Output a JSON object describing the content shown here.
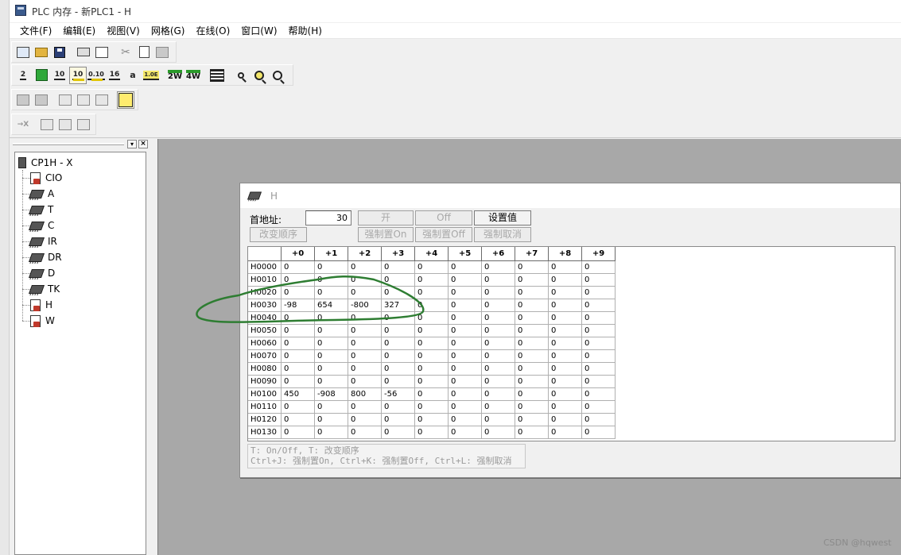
{
  "window": {
    "title": "PLC 内存 - 新PLC1 - H"
  },
  "menu": [
    "文件(F)",
    "编辑(E)",
    "视图(V)",
    "网格(G)",
    "在线(O)",
    "窗口(W)",
    "帮助(H)"
  ],
  "toolbar": {
    "row2_labels": [
      "2",
      "10",
      "10",
      "16",
      "a",
      "2W",
      "4W"
    ]
  },
  "tree": {
    "root": "CP1H - X",
    "items": [
      {
        "label": "CIO",
        "icon": "memory-doc-icon"
      },
      {
        "label": "A",
        "icon": "memory-chip-icon"
      },
      {
        "label": "T",
        "icon": "memory-chip-icon"
      },
      {
        "label": "C",
        "icon": "memory-chip-icon"
      },
      {
        "label": "IR",
        "icon": "memory-chip-icon"
      },
      {
        "label": "DR",
        "icon": "memory-chip-icon"
      },
      {
        "label": "D",
        "icon": "memory-chip-icon"
      },
      {
        "label": "TK",
        "icon": "memory-chip-icon"
      },
      {
        "label": "H",
        "icon": "memory-doc-icon"
      },
      {
        "label": "W",
        "icon": "memory-doc-icon"
      }
    ]
  },
  "child": {
    "title": "H",
    "address_label": "首地址:",
    "address_value": "30",
    "buttons": {
      "on": "开",
      "off": "Off",
      "set_value": "设置值",
      "change_order": "改变顺序",
      "force_on": "强制置On",
      "force_off": "强制置Off",
      "force_cancel": "强制取消"
    },
    "columns": [
      "+0",
      "+1",
      "+2",
      "+3",
      "+4",
      "+5",
      "+6",
      "+7",
      "+8",
      "+9"
    ],
    "rows": [
      {
        "addr": "H0000",
        "vals": [
          "0",
          "0",
          "0",
          "0",
          "0",
          "0",
          "0",
          "0",
          "0",
          "0"
        ]
      },
      {
        "addr": "H0010",
        "vals": [
          "0",
          "0",
          "0",
          "0",
          "0",
          "0",
          "0",
          "0",
          "0",
          "0"
        ]
      },
      {
        "addr": "H0020",
        "vals": [
          "0",
          "0",
          "0",
          "0",
          "0",
          "0",
          "0",
          "0",
          "0",
          "0"
        ]
      },
      {
        "addr": "H0030",
        "vals": [
          "-98",
          "654",
          "-800",
          "327",
          "0",
          "0",
          "0",
          "0",
          "0",
          "0"
        ]
      },
      {
        "addr": "H0040",
        "vals": [
          "0",
          "0",
          "0",
          "0",
          "0",
          "0",
          "0",
          "0",
          "0",
          "0"
        ]
      },
      {
        "addr": "H0050",
        "vals": [
          "0",
          "0",
          "0",
          "0",
          "0",
          "0",
          "0",
          "0",
          "0",
          "0"
        ]
      },
      {
        "addr": "H0060",
        "vals": [
          "0",
          "0",
          "0",
          "0",
          "0",
          "0",
          "0",
          "0",
          "0",
          "0"
        ]
      },
      {
        "addr": "H0070",
        "vals": [
          "0",
          "0",
          "0",
          "0",
          "0",
          "0",
          "0",
          "0",
          "0",
          "0"
        ]
      },
      {
        "addr": "H0080",
        "vals": [
          "0",
          "0",
          "0",
          "0",
          "0",
          "0",
          "0",
          "0",
          "0",
          "0"
        ]
      },
      {
        "addr": "H0090",
        "vals": [
          "0",
          "0",
          "0",
          "0",
          "0",
          "0",
          "0",
          "0",
          "0",
          "0"
        ]
      },
      {
        "addr": "H0100",
        "vals": [
          "450",
          "-908",
          "800",
          "-56",
          "0",
          "0",
          "0",
          "0",
          "0",
          "0"
        ]
      },
      {
        "addr": "H0110",
        "vals": [
          "0",
          "0",
          "0",
          "0",
          "0",
          "0",
          "0",
          "0",
          "0",
          "0"
        ]
      },
      {
        "addr": "H0120",
        "vals": [
          "0",
          "0",
          "0",
          "0",
          "0",
          "0",
          "0",
          "0",
          "0",
          "0"
        ]
      },
      {
        "addr": "H0130",
        "vals": [
          "0",
          "0",
          "0",
          "0",
          "0",
          "0",
          "0",
          "0",
          "0",
          "0"
        ]
      }
    ],
    "hint_line1": "T: On/Off,   T: 改变顺序",
    "hint_line2": "Ctrl+J: 强制置On,  Ctrl+K:  强制置Off,  Ctrl+L: 强制取消"
  },
  "colors": {
    "annotation": "#2e7d32",
    "mdi_background": "#a8a8a8"
  },
  "watermark": "CSDN @hqwest"
}
